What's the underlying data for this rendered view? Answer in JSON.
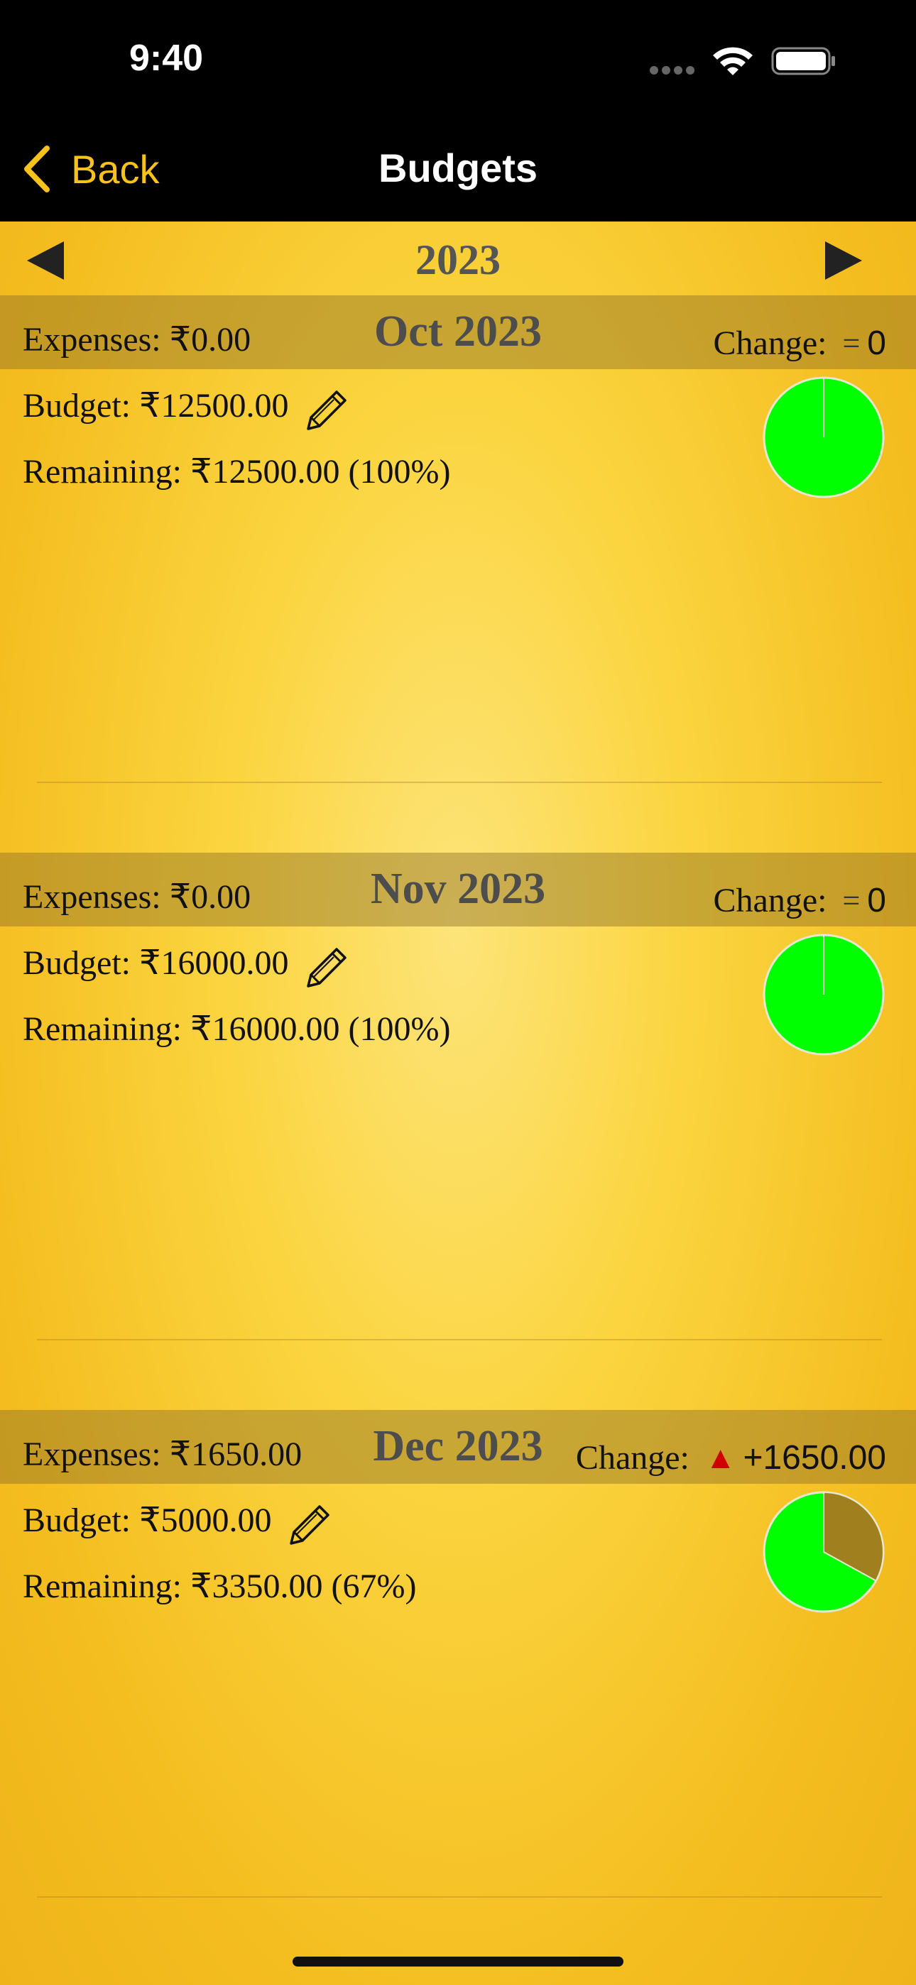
{
  "status": {
    "time": "9:40"
  },
  "nav": {
    "back_label": "Back",
    "title": "Budgets"
  },
  "year": "2023",
  "months": [
    {
      "title": "Oct 2023",
      "expenses": "Expenses: ₹0.00",
      "budget": "Budget: ₹12500.00",
      "remaining": "Remaining: ₹12500.00 (100%)",
      "change_label": "Change:",
      "change_symbol": "=",
      "change_value": "0",
      "spent_fraction": 0
    },
    {
      "title": "Nov 2023",
      "expenses": "Expenses: ₹0.00",
      "budget": "Budget: ₹16000.00",
      "remaining": "Remaining: ₹16000.00 (100%)",
      "change_label": "Change:",
      "change_symbol": "=",
      "change_value": "0",
      "spent_fraction": 0
    },
    {
      "title": "Dec 2023",
      "expenses": "Expenses: ₹1650.00",
      "budget": "Budget: ₹5000.00",
      "remaining": "Remaining: ₹3350.00 (67%)",
      "change_label": "Change:",
      "change_symbol": "▲",
      "change_value": "+1650.00",
      "spent_fraction": 0.33
    }
  ],
  "colors": {
    "accent": "#f7c21b",
    "remaining": "#00ff00",
    "spent": "#a07f1f",
    "increase": "#d10000"
  }
}
